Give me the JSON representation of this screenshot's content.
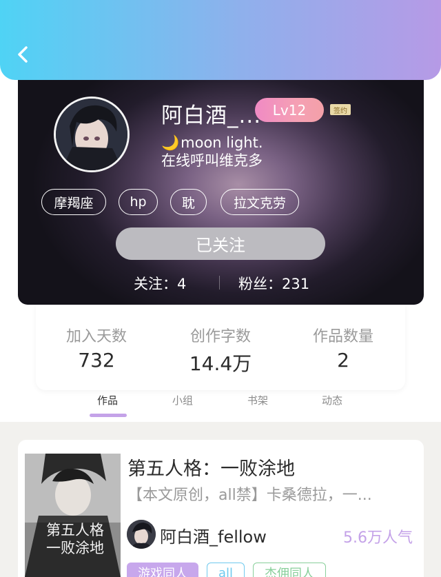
{
  "header": {
    "back_icon": "chevron-left-icon"
  },
  "profile": {
    "username": "阿白酒_...",
    "level": "Lv12",
    "sign_badge": "签约",
    "bio_line1": "moon light.",
    "bio_moon": "🌙",
    "bio_line2": "在线呼叫维克多",
    "tags": [
      "摩羯座",
      "hp",
      "耽",
      "拉文克劳"
    ],
    "follow_button": "已关注",
    "following": "关注：4",
    "fans": "粉丝：231"
  },
  "stats": [
    {
      "label": "加入天数",
      "value": "732"
    },
    {
      "label": "创作字数",
      "value": "14.4万"
    },
    {
      "label": "作品数量",
      "value": "2"
    }
  ],
  "tabs": [
    "作品",
    "小组",
    "书架",
    "动态"
  ],
  "work": {
    "title": "第五人格：一败涂地",
    "description": "【本文原创，all禁】卡桑德拉，一...",
    "cover_text": "第五人格 一败涂地",
    "author": "阿白酒_fellow",
    "popularity": "5.6万人气",
    "tags": [
      "游戏同人",
      "all",
      "杰佣同人"
    ]
  },
  "colors": {
    "accent_purple": "#c4a2e8",
    "header_start": "#4fd3f5",
    "header_end": "#b69ae6",
    "level_badge": "#f08ac4"
  }
}
